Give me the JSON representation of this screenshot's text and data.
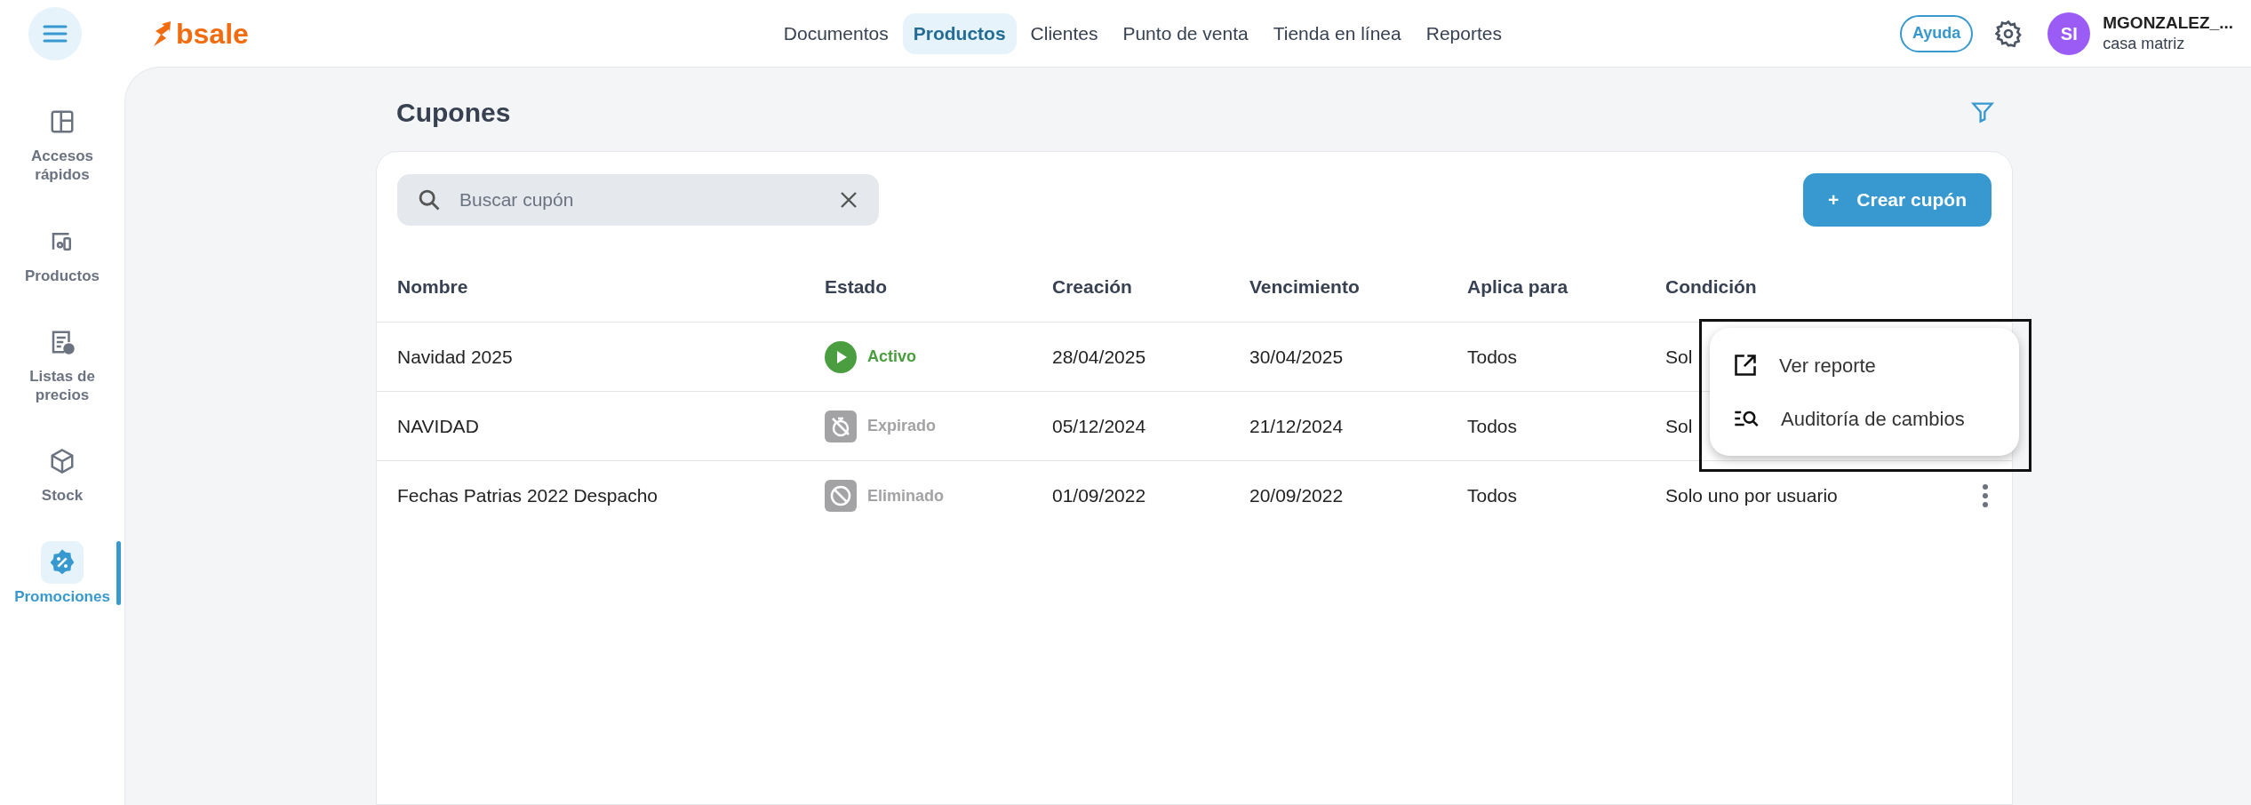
{
  "top_bar": {
    "logo": "bsale",
    "nav": [
      {
        "label": "Documentos",
        "selected": false
      },
      {
        "label": "Productos",
        "selected": true
      },
      {
        "label": "Clientes",
        "selected": false
      },
      {
        "label": "Punto de venta",
        "selected": false
      },
      {
        "label": "Tienda en línea",
        "selected": false
      },
      {
        "label": "Reportes",
        "selected": false
      }
    ],
    "help": "Ayuda",
    "user": {
      "initials": "SI",
      "name": "MGONZALEZ_...",
      "branch": "casa matriz"
    }
  },
  "sidebar": {
    "items": [
      {
        "label": "Accesos rápidos",
        "kind": "layout",
        "selected": false
      },
      {
        "label": "Productos",
        "kind": "devices",
        "selected": false
      },
      {
        "label": "Listas de precios",
        "kind": "pricelist",
        "selected": false
      },
      {
        "label": "Stock",
        "kind": "box",
        "selected": false
      },
      {
        "label": "Promociones",
        "kind": "percent",
        "selected": true
      }
    ]
  },
  "page": {
    "title": "Cupones",
    "search": {
      "placeholder": "Buscar cupón"
    },
    "create_button": "Crear cupón",
    "create_icon": "+",
    "table": {
      "columns": [
        "Nombre",
        "Estado",
        "Creación",
        "Vencimiento",
        "Aplica para",
        "Condición"
      ],
      "rows": [
        {
          "name": "Navidad 2025",
          "status": {
            "kind": "active",
            "label": "Activo"
          },
          "created": "28/04/2025",
          "expires": "30/04/2025",
          "applies": "Todos",
          "condition": "Sol",
          "actions_visible": false
        },
        {
          "name": "NAVIDAD",
          "status": {
            "kind": "expired",
            "label": "Expirado"
          },
          "created": "05/12/2024",
          "expires": "21/12/2024",
          "applies": "Todos",
          "condition": "Sol",
          "actions_visible": false
        },
        {
          "name": "Fechas Patrias 2022 Despacho",
          "status": {
            "kind": "deleted",
            "label": "Eliminado"
          },
          "created": "01/09/2022",
          "expires": "20/09/2022",
          "applies": "Todos",
          "condition": "Solo uno por usuario",
          "actions_visible": true
        }
      ]
    },
    "context_menu": {
      "items": [
        {
          "label": "Ver reporte",
          "kind": "external"
        },
        {
          "label": "Auditoría de cambios",
          "kind": "audit"
        }
      ]
    }
  }
}
